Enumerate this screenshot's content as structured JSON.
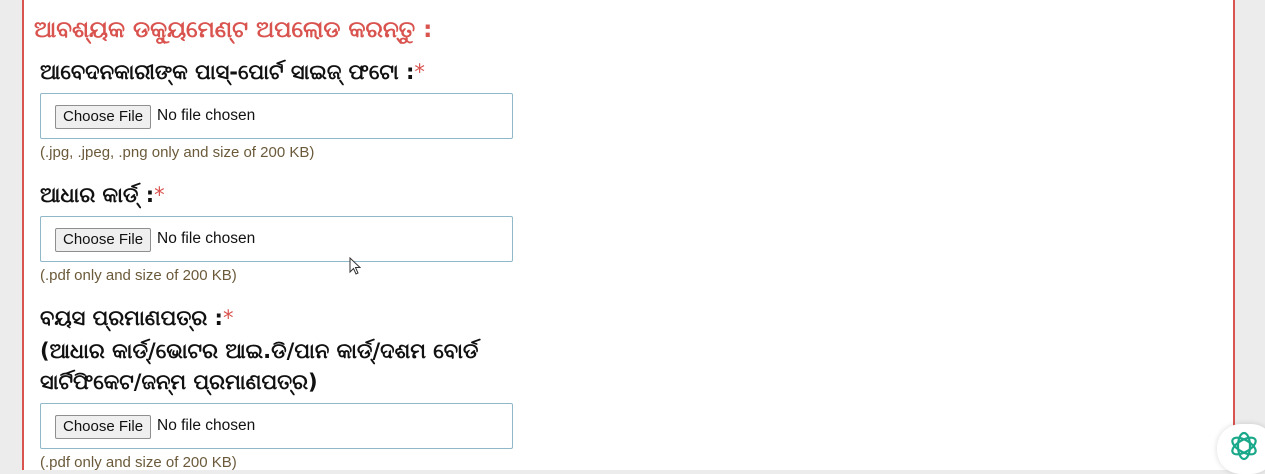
{
  "section": {
    "title": "ଆବଶ୍ୟକ ଡକ୍ୟୁମେଣ୍ଟ ଅପଲୋଡ କରନ୍ତୁ :"
  },
  "required_mark": "*",
  "fields": [
    {
      "label": "ଆବେଦନକାରୀଙ୍କ ପାସ୍-ପୋର୍ଟ ସାଇଜ୍ ଫଟୋ :",
      "button": "Choose File",
      "status": "No file chosen",
      "hint": "(.jpg, .jpeg, .png only and size of 200 KB)"
    },
    {
      "label": "ଆଧାର କାର୍ଡ୍ :",
      "button": "Choose File",
      "status": "No file chosen",
      "hint": "(.pdf only and size of 200 KB)"
    },
    {
      "label": "ବୟସ ପ୍ରମାଣପତ୍ର :",
      "sublabel_line1": "(ଆଧାର କାର୍ଡ୍/ଭୋଟର ଆଇ.ଡି/ପାନ କାର୍ଡ୍/ଦଶମ ବୋର୍ଡ",
      "sublabel_line2": "ସାର୍ଟିଫିକେଟ/ଜନ୍ମ ପ୍ରମାଣପତ୍ର)",
      "button": "Choose File",
      "status": "No file chosen",
      "hint": "(.pdf only and size of 200 KB)"
    }
  ],
  "colors": {
    "accent": "#d9534f",
    "border": "#8fb8c8",
    "hint": "#6b5a3a"
  },
  "icons": {
    "fab": "openai-logo-icon",
    "cursor": "mouse-pointer-icon"
  }
}
